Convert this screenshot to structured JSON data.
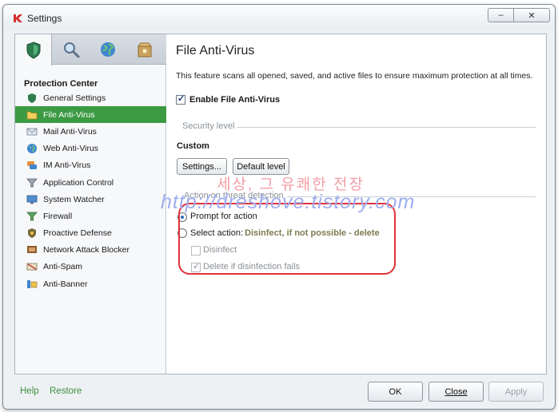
{
  "window": {
    "title": "Settings",
    "minimize_glyph": "–",
    "close_glyph": "✕"
  },
  "tabs": [
    {
      "name": "protection-tab",
      "icon": "shield-icon"
    },
    {
      "name": "scan-tab",
      "icon": "magnifier-icon"
    },
    {
      "name": "update-tab",
      "icon": "globe-icon"
    },
    {
      "name": "settings-tab",
      "icon": "box-icon"
    }
  ],
  "sidebar": {
    "title": "Protection Center",
    "items": [
      {
        "label": "General Settings",
        "icon": "shield-icon"
      },
      {
        "label": "File Anti-Virus",
        "icon": "folder-icon"
      },
      {
        "label": "Mail Anti-Virus",
        "icon": "envelope-icon"
      },
      {
        "label": "Web Anti-Virus",
        "icon": "globe-icon"
      },
      {
        "label": "IM Anti-Virus",
        "icon": "chat-icon"
      },
      {
        "label": "Application Control",
        "icon": "funnel-icon"
      },
      {
        "label": "System Watcher",
        "icon": "monitor-icon"
      },
      {
        "label": "Firewall",
        "icon": "filter-icon"
      },
      {
        "label": "Proactive Defense",
        "icon": "shield-badge-icon"
      },
      {
        "label": "Network Attack Blocker",
        "icon": "network-icon"
      },
      {
        "label": "Anti-Spam",
        "icon": "spam-icon"
      },
      {
        "label": "Anti-Banner",
        "icon": "banner-icon"
      }
    ],
    "selected_index": 1
  },
  "main": {
    "title": "File Anti-Virus",
    "description": "This feature scans all opened, saved, and active files to ensure maximum protection at all times.",
    "enable_label": "Enable File Anti-Virus",
    "security_level": {
      "group_title": "Security level",
      "level_name": "Custom",
      "settings_button": "Settings...",
      "default_button": "Default level"
    },
    "action": {
      "group_title": "Action on threat detection",
      "prompt_label": "Prompt for action",
      "select_label": "Select action:",
      "select_value": "Disinfect, if not possible - delete",
      "disinfect_label": "Disinfect",
      "delete_label": "Delete if disinfection fails"
    }
  },
  "watermark": {
    "korean": "세상, 그 유쾌한 전장",
    "url": "http://dreshove.tistory.com"
  },
  "footer": {
    "help": "Help",
    "restore": "Restore",
    "ok": "OK",
    "close": "Close",
    "apply": "Apply"
  },
  "colors": {
    "accent_green": "#3c9a42",
    "highlight_red": "#e2323a"
  }
}
